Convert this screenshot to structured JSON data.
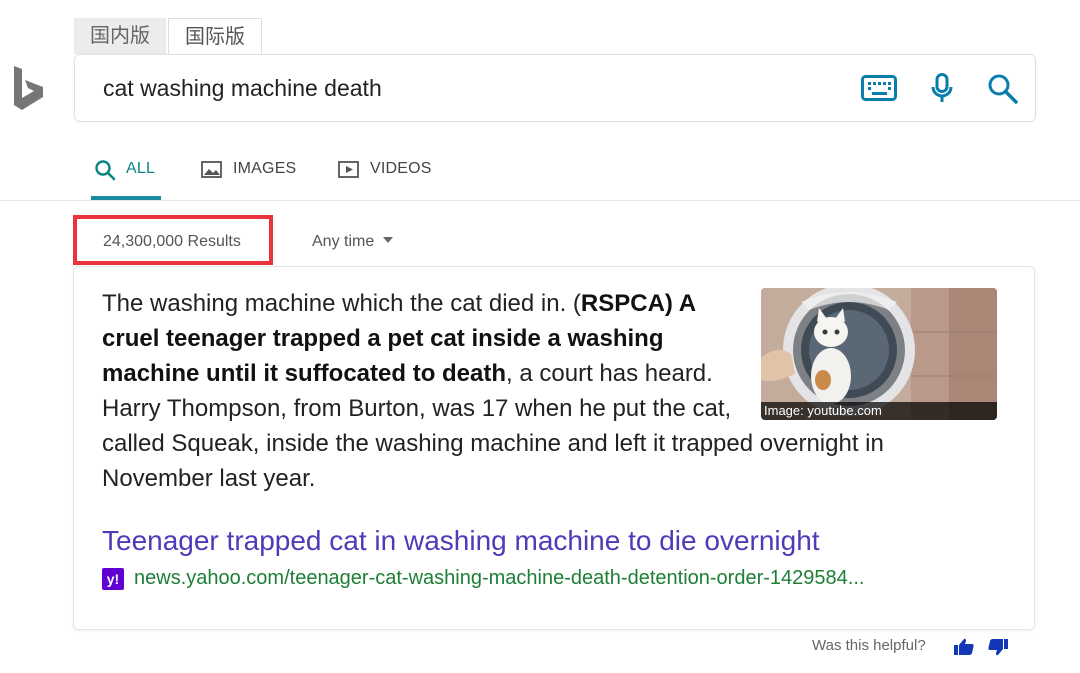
{
  "region_tabs": [
    "国内版",
    "国际版"
  ],
  "search": {
    "query": "cat washing machine death"
  },
  "scope_tabs": [
    {
      "label": "ALL"
    },
    {
      "label": "IMAGES"
    },
    {
      "label": "VIDEOS"
    }
  ],
  "results": {
    "count": "24,300,000 Results",
    "filter": "Any time"
  },
  "answer": {
    "text_1": "The washing machine which the cat died in. (",
    "bold": "RSPCA) A cruel teenager trapped a pet cat inside a washing machine until it suffocated to death",
    "text_2": ", a court has heard. Harry Thompson, from Burton, was 17 when he put the cat, called Squeak, inside the washing machine and left it trapped overnight in November last year.",
    "image_credit": "Image: youtube.com",
    "title": "Teenager trapped cat in washing machine to die overnight",
    "url": "news.yahoo.com/teenager-cat-washing-machine-death-detention-order-1429584...",
    "source_icon": "y!"
  },
  "feedback": {
    "question": "Was this helpful?"
  },
  "colors": {
    "accent": "#1a8a9c",
    "link": "#4d3bb8",
    "url": "#1d7f36",
    "highlight": "#e8343a",
    "yahoo": "#6001d2"
  }
}
